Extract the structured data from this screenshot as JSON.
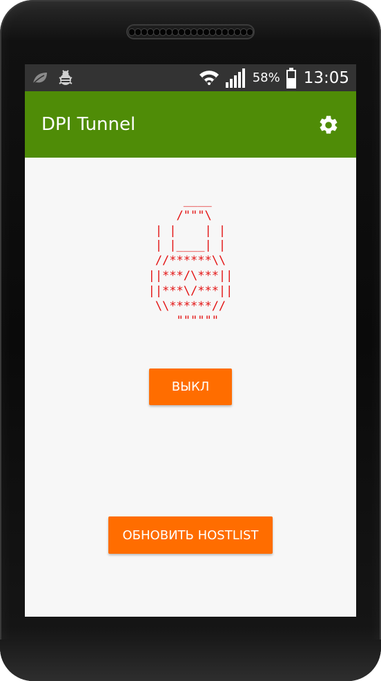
{
  "status_bar": {
    "battery_percent": "58%",
    "time": "13:05",
    "left_icons": [
      "leaf-icon",
      "bug-icon"
    ],
    "right_icons": [
      "wifi-icon",
      "signal-icon",
      "battery-icon"
    ]
  },
  "app_bar": {
    "title": "DPI Tunnel",
    "settings_icon": "gear-icon",
    "color": "#4f8c07"
  },
  "main": {
    "lock_art": "  ____\n /\"\"\"\\\n| |    | |\n| |____| |\n//******\\\\\n||***/\\***||\n||***\\/***||\n\\\\******//\n  \"\"\"\"\"\"",
    "lock_art_color": "#e31313",
    "toggle_button": "ВЫКЛ",
    "update_hostlist_button": "ОБНОВИТЬ HOSTLIST",
    "button_color": "#ff6d00"
  }
}
